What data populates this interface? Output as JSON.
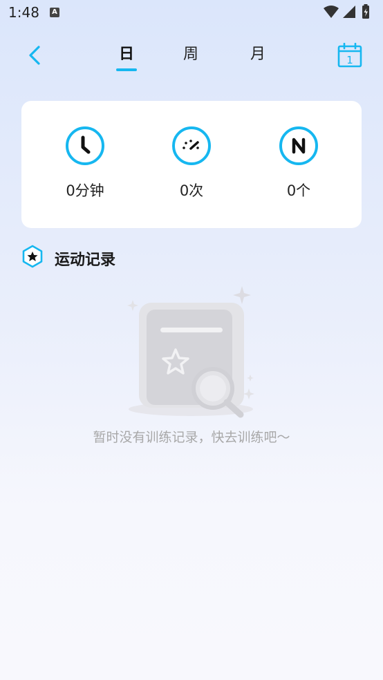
{
  "status_bar": {
    "time": "1:48",
    "notification_letter": "A"
  },
  "nav": {
    "tabs": [
      {
        "label": "日",
        "active": true
      },
      {
        "label": "周",
        "active": false
      },
      {
        "label": "月",
        "active": false
      }
    ],
    "calendar_day": "1",
    "accent_color": "#16b7f0"
  },
  "stats": [
    {
      "icon": "clock-icon",
      "value": "0分钟"
    },
    {
      "icon": "speedometer-icon",
      "value": "0次"
    },
    {
      "icon": "n-letter-icon",
      "value": "0个"
    }
  ],
  "records": {
    "title": "运动记录",
    "empty_message": "暂时没有训练记录，快去训练吧～"
  }
}
